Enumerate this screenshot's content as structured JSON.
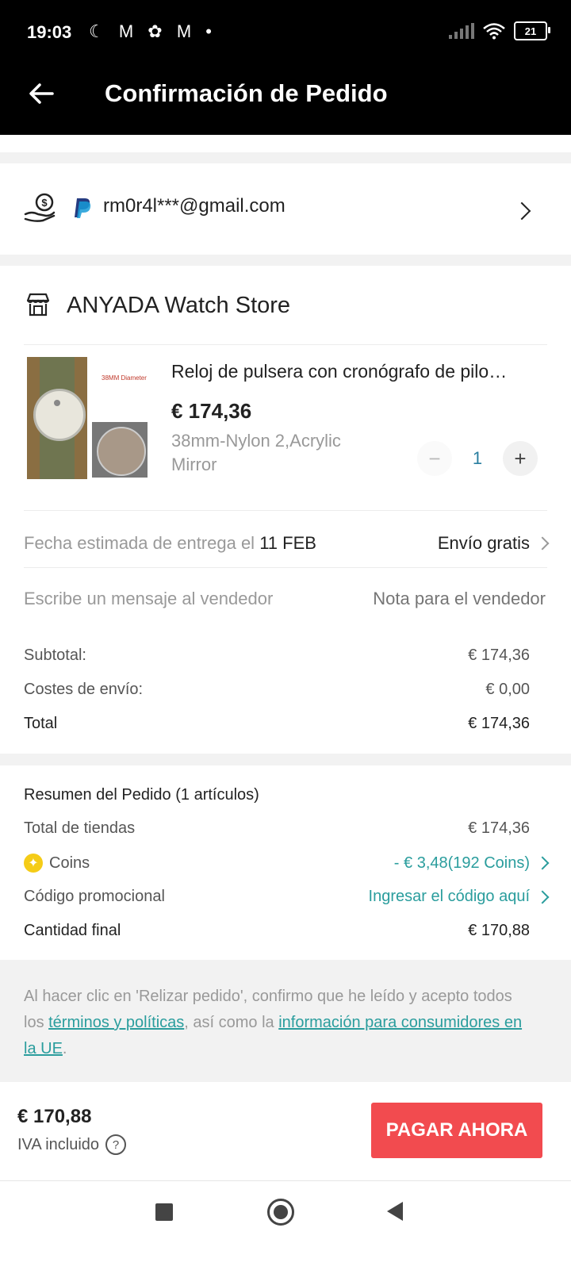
{
  "status_bar": {
    "time": "19:03",
    "icons": "☾ M ✿ M •",
    "battery": "21"
  },
  "header": {
    "title": "Confirmación de Pedido"
  },
  "payment": {
    "email": "rm0r4l***@gmail.com"
  },
  "store": {
    "name": "ANYADA Watch Store",
    "product": {
      "title": "Reloj de pulsera con cronógrafo de pilo…",
      "price": "€ 174,36",
      "variant": "38mm-Nylon 2,Acrylic Mirror",
      "image_caption": "38MM Diameter",
      "quantity": "1",
      "minus": "−",
      "plus": "+"
    },
    "delivery": {
      "label": "Fecha estimada de entrega el ",
      "date": "11 FEB",
      "shipping": "Envío gratis"
    },
    "message": {
      "label": "Escribe un mensaje al vendedor",
      "placeholder": "Nota para el vendedor"
    },
    "totals": [
      {
        "label": "Subtotal:",
        "value": "€ 174,36"
      },
      {
        "label": "Costes de envío:",
        "value": "€ 0,00"
      },
      {
        "label": "Total",
        "value": "€ 174,36"
      }
    ]
  },
  "summary": {
    "title": "Resumen del Pedido (1 artículos)",
    "store_total_label": "Total de tiendas",
    "store_total_value": "€ 174,36",
    "coins_label": "Coins",
    "coins_value": "- € 3,48(192 Coins)",
    "promo_label": "Código promocional",
    "promo_value": "Ingresar el código aquí",
    "final_label": "Cantidad final",
    "final_value": "€ 170,88"
  },
  "legal": {
    "part1": "Al hacer clic en 'Relizar pedido', confirmo que he leído y acepto todos los ",
    "link1": "términos y políticas",
    "part2": ", así como la ",
    "link2": "información para consumidores en la UE",
    "part3": "."
  },
  "footer": {
    "total": "€ 170,88",
    "tax": "IVA incluido",
    "help": "?",
    "pay_button": "PAGAR AHORA"
  },
  "colors": {
    "accent": "#f24b4f",
    "teal": "#2a9d9d",
    "header_bg": "#000000"
  }
}
